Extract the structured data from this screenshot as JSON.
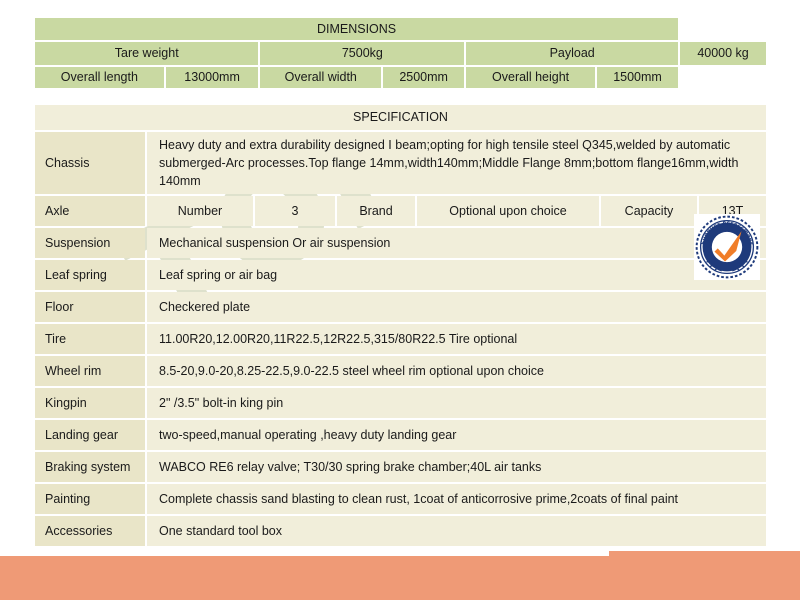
{
  "document": {
    "watermark_text": "TOP LEAD",
    "accent_green": "#c9d9a2",
    "accent_cream": "#f1eeda",
    "accent_label": "#e9e5c8",
    "accent_orange": "#ef9a76"
  },
  "dimensions": {
    "title": "DIMENSIONS",
    "rows": [
      [
        {
          "text": "Tare weight",
          "span": 2
        },
        {
          "text": "7500kg",
          "span": 2
        },
        {
          "text": "Payload",
          "span": 2
        },
        {
          "text": "40000 kg",
          "span": 2
        }
      ],
      [
        {
          "text": "Overall length",
          "span": 1
        },
        {
          "text": "13000mm",
          "span": 1
        },
        {
          "text": "Overall width",
          "span": 1
        },
        {
          "text": "2500mm",
          "span": 1
        },
        {
          "text": "Overall height",
          "span": 1
        },
        {
          "text": "1500mm",
          "span": 1
        }
      ]
    ]
  },
  "specification": {
    "title": "SPECIFICATION",
    "rows": [
      {
        "label": "Chassis",
        "value": "Heavy duty and extra durability designed I beam;opting for high tensile steel Q345,welded by automatic submerged-Arc processes.Top flange 14mm,width140mm;Middle Flange 8mm;bottom flange16mm,width 140mm"
      },
      {
        "label": "Axle",
        "cells": [
          "Number",
          "3",
          "Brand",
          "Optional upon choice",
          "Capacity",
          "13T"
        ]
      },
      {
        "label": "Suspension",
        "value": "Mechanical suspension Or air suspension"
      },
      {
        "label": "Leaf spring",
        "value": "Leaf spring or air bag"
      },
      {
        "label": "Floor",
        "value": "Checkered plate"
      },
      {
        "label": "Tire",
        "value": "11.00R20,12.00R20,11R22.5,12R22.5,315/80R22.5 Tire optional"
      },
      {
        "label": "Wheel rim",
        "value": "8.5-20,9.0-20,8.25-22.5,9.0-22.5 steel wheel rim optional upon choice"
      },
      {
        "label": "Kingpin",
        "value": "2\" /3.5\" bolt-in king pin"
      },
      {
        "label": "Landing gear",
        "value": "two-speed,manual operating ,heavy duty landing gear"
      },
      {
        "label": "Braking system",
        "value": "WABCO RE6 relay valve; T30/30 spring brake chamber;40L air tanks"
      },
      {
        "label": "Painting",
        "value": "Complete chassis sand blasting to clean rust, 1coat of anticorrosive prime,2coats of final paint"
      },
      {
        "label": "Accessories",
        "value": "One standard tool box"
      }
    ]
  },
  "badge": {
    "text_top": "Supplier Assessment",
    "ring_color": "#1e3a7b",
    "check_color": "#f07d28"
  }
}
